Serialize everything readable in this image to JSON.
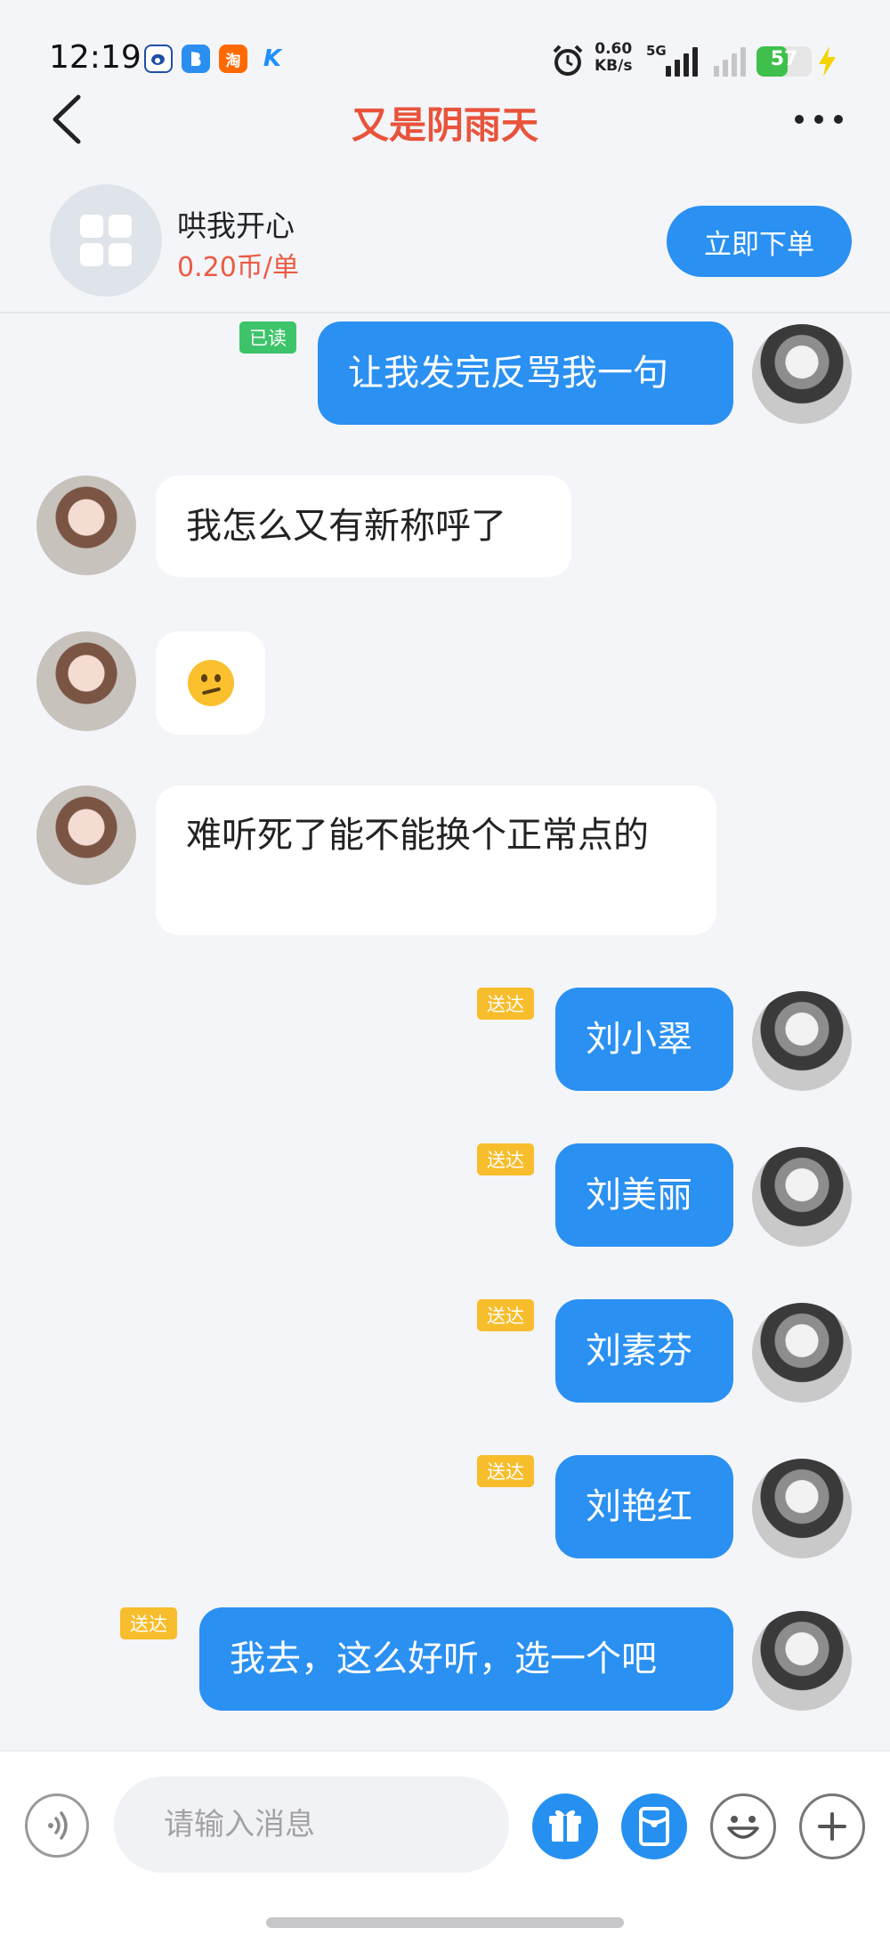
{
  "status_bar": {
    "time": "12:19",
    "apps": [
      {
        "name": "weibo-icon",
        "glyph": "◔",
        "color": "#ffffff",
        "fg": "#1d4fa5"
      },
      {
        "name": "bluebird-icon",
        "glyph": "b",
        "color": "#2b8ff0",
        "fg": "#ffffff"
      },
      {
        "name": "taobao-icon",
        "glyph": "淘",
        "color": "#ff6a00",
        "fg": "#ffffff"
      },
      {
        "name": "k-app-icon",
        "glyph": "K",
        "color": "#ffffff",
        "fg": "#1e90ff"
      }
    ],
    "net_speed_value": "0.60",
    "net_speed_unit": "KB/s",
    "network": "5G",
    "battery": "57",
    "battery_level": 0.57
  },
  "nav": {
    "title": "又是阴雨天"
  },
  "service": {
    "name": "哄我开心",
    "price": "0.20币/单",
    "order_button": "立即下单"
  },
  "messages": [
    {
      "side": "out",
      "text": "让我发完反骂我一句",
      "status": "已读"
    },
    {
      "side": "in",
      "text": "我怎么又有新称呼了"
    },
    {
      "side": "in",
      "emoji": "confused-face"
    },
    {
      "side": "in",
      "text": "难听死了能不能换个正常点的"
    },
    {
      "side": "out",
      "text": "刘小翠",
      "status": "送达"
    },
    {
      "side": "out",
      "text": "刘美丽",
      "status": "送达"
    },
    {
      "side": "out",
      "text": "刘素芬",
      "status": "送达"
    },
    {
      "side": "out",
      "text": "刘艳红",
      "status": "送达"
    },
    {
      "side": "out",
      "text": "我去，这么好听，选一个吧",
      "status": "送达"
    }
  ],
  "input": {
    "placeholder": "请输入消息"
  },
  "colors": {
    "accent": "#2a90f2",
    "title_red": "#e9533b",
    "read_tag": "#3dc46a",
    "sent_tag": "#f8bd2c"
  }
}
